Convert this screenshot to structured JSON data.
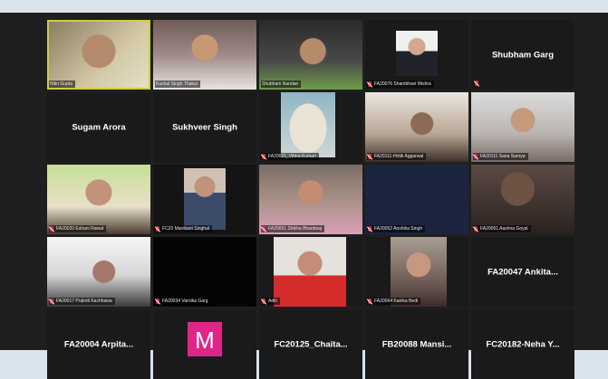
{
  "colors": {
    "page_bg": "#d9e3ec",
    "meeting_bg": "#1f1f1f",
    "tile_bg": "#1a1a1a",
    "active_speaker_border": "#c9d13a",
    "muted_mic": "#e0383e",
    "avatar_bg": "#e0258a"
  },
  "participants": [
    {
      "label": "Nitin Gupta",
      "type": "video",
      "muted": false,
      "active": true
    },
    {
      "label": "Kushal Singh Thakur",
      "type": "video",
      "muted": false
    },
    {
      "label": "Shubham Nandan",
      "type": "video",
      "muted": false
    },
    {
      "label": "FA20076 Shambhavi Mishra",
      "type": "video",
      "muted": true
    },
    {
      "label": "Shubham Garg",
      "type": "name",
      "muted": true
    },
    {
      "label": "Sugam Arora",
      "type": "name",
      "muted": false
    },
    {
      "label": "Sukhveer Singh",
      "type": "name",
      "muted": false
    },
    {
      "label": "FA20021_Vibha Kumari",
      "type": "video",
      "muted": true
    },
    {
      "label": "FA20111-Hritik Aggarwal",
      "type": "video",
      "muted": true
    },
    {
      "label": "FA20111 Sana Saroya",
      "type": "video",
      "muted": true
    },
    {
      "label": "FA20020 Eshani Rawat",
      "type": "video",
      "muted": true
    },
    {
      "label": "FC20 Manikant Singhal",
      "type": "video",
      "muted": true
    },
    {
      "label": "FA20051 Shikha Bhardwaj",
      "type": "video",
      "muted": true
    },
    {
      "label": "FA20052 Anshika Singh",
      "type": "video",
      "muted": true
    },
    {
      "label": "FA20061 Aashna Goyal",
      "type": "video",
      "muted": true
    },
    {
      "label": "FA20017 Prakriti Kachhawa",
      "type": "video",
      "muted": true
    },
    {
      "label": "FA20034 Varnika Garg",
      "type": "video",
      "muted": true
    },
    {
      "label": "Aditi",
      "type": "video",
      "muted": true
    },
    {
      "label": "FA20064 Kanika Bedi",
      "type": "video",
      "muted": true
    },
    {
      "label": "FA20047  Ankita...",
      "type": "name",
      "muted": false
    },
    {
      "label": "FA20004  Arpita...",
      "type": "name",
      "muted": false
    },
    {
      "label": "",
      "type": "avatar",
      "avatar": "M",
      "muted": false
    },
    {
      "label": "FC20125_Chaita...",
      "type": "name",
      "muted": false
    },
    {
      "label": "FB20088  Mansi...",
      "type": "name",
      "muted": false
    },
    {
      "label": "FC20182-Neha  Y...",
      "type": "name",
      "muted": false
    }
  ]
}
